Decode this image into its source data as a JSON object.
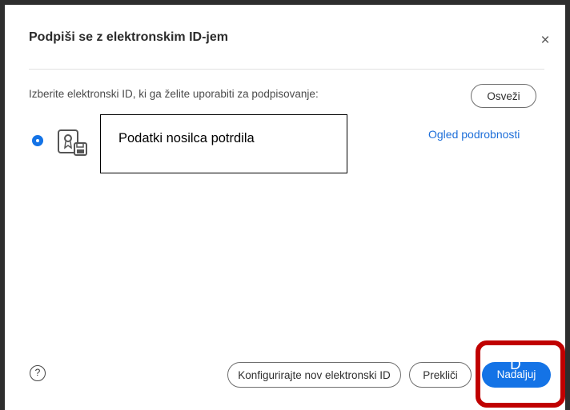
{
  "dialog": {
    "title": "Podpiši se z elektronskim ID-jem",
    "close_symbol": "×",
    "instruction": "Izberite elektronski ID, ki ga želite uporabiti za podpisovanje:",
    "refresh_label": "Osveži",
    "certificate": {
      "label": "Podatki nosilca potrdila",
      "selected": true,
      "icon": "certificate-icon"
    },
    "details_link": "Ogled podrobnosti",
    "help_symbol": "?",
    "buttons": {
      "configure": "Konfigurirajte nov elektronski ID",
      "cancel": "Prekliči",
      "continue": "Nadaljuj"
    },
    "cursor_glyph": "D"
  },
  "colors": {
    "accent": "#1473e6",
    "highlight": "#c00000",
    "frame": "#2e2e2e"
  }
}
